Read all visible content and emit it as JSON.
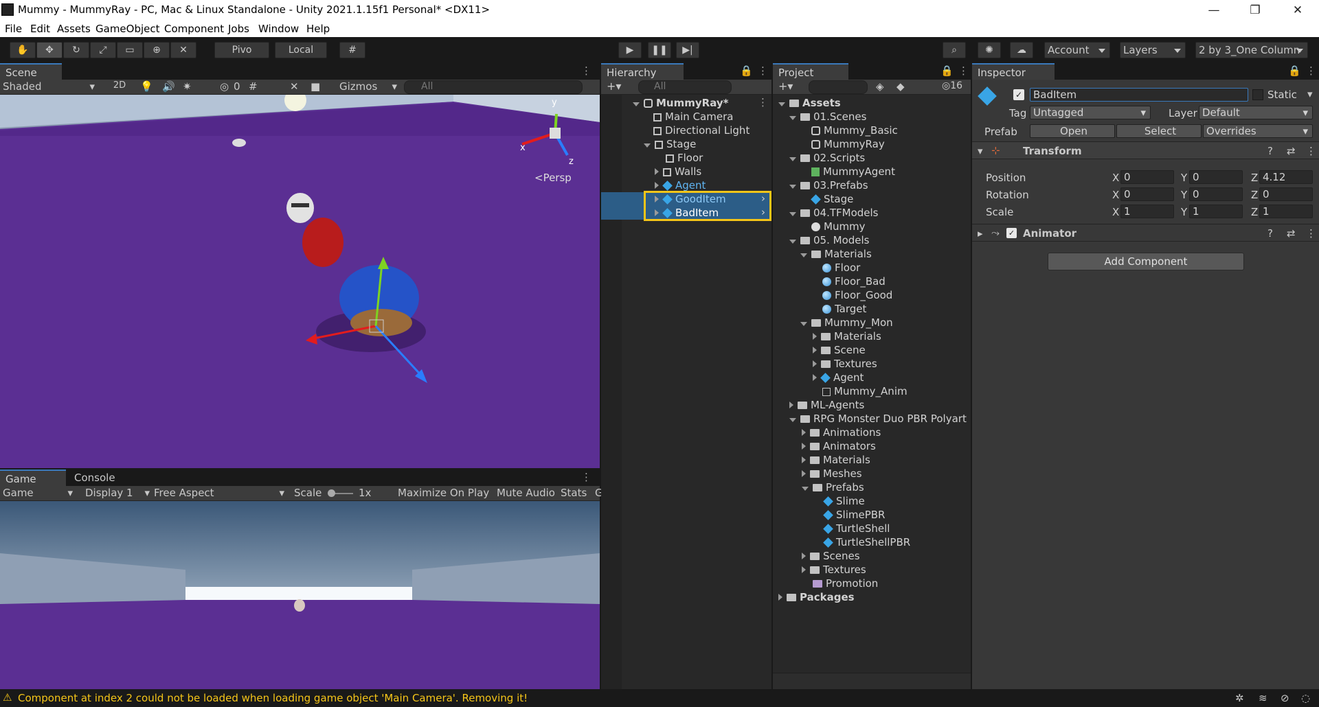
{
  "window": {
    "title": "Mummy - MummyRay - PC, Mac & Linux Standalone - Unity 2021.1.15f1 Personal* <DX11>"
  },
  "menu": [
    "File",
    "Edit",
    "Assets",
    "GameObject",
    "Component",
    "Jobs",
    "Window",
    "Help"
  ],
  "toolbar": {
    "pivot": "Pivo",
    "local": "Local",
    "account": "Account",
    "layers": "Layers",
    "layout": "2 by 3_One Column"
  },
  "scene": {
    "tab": "Scene",
    "shading": "Shaded",
    "mode2d": "2D",
    "hidden_count": "0",
    "gizmos": "Gizmos",
    "search_placeholder": "All",
    "persp": "<Persp",
    "axis_x": "x",
    "axis_y": "y",
    "axis_z": "z"
  },
  "game": {
    "tab_game": "Game",
    "tab_console": "Console",
    "view": "Game",
    "display": "Display 1",
    "aspect": "Free Aspect",
    "scale_label": "Scale",
    "scale_value": "1x",
    "maximize": "Maximize On Play",
    "mute": "Mute Audio",
    "stats": "Stats",
    "gizmos_cut": "G"
  },
  "hierarchy": {
    "tab": "Hierarchy",
    "search_placeholder": "All",
    "scene_root": "MummyRay*",
    "items": [
      "Main Camera",
      "Directional Light",
      "Stage",
      "Floor",
      "Walls",
      "Agent",
      "GoodItem",
      "BadItem"
    ]
  },
  "project": {
    "tab": "Project",
    "hidden_count": "16",
    "items": [
      "Assets",
      "01.Scenes",
      "Mummy_Basic",
      "MummyRay",
      "02.Scripts",
      "MummyAgent",
      "03.Prefabs",
      "Stage",
      "04.TFModels",
      "Mummy",
      "05. Models",
      "Materials",
      "Floor",
      "Floor_Bad",
      "Floor_Good",
      "Target",
      "Mummy_Mon",
      "Materials",
      "Scene",
      "Textures",
      "Agent",
      "Mummy_Anim",
      "ML-Agents",
      "RPG Monster Duo PBR Polyart",
      "Animations",
      "Animators",
      "Materials",
      "Meshes",
      "Prefabs",
      "Slime",
      "SlimePBR",
      "TurtleShell",
      "TurtleShellPBR",
      "Scenes",
      "Textures",
      "Promotion",
      "Packages"
    ]
  },
  "inspector": {
    "tab": "Inspector",
    "object_name": "BadItem",
    "static_label": "Static",
    "tag_label": "Tag",
    "tag_value": "Untagged",
    "layer_label": "Layer",
    "layer_value": "Default",
    "prefab_label": "Prefab",
    "open": "Open",
    "select": "Select",
    "overrides": "Overrides",
    "transform_title": "Transform",
    "position_label": "Position",
    "rotation_label": "Rotation",
    "scale_label": "Scale",
    "x": "X",
    "y": "Y",
    "z": "Z",
    "position": [
      "0",
      "0",
      "4.12"
    ],
    "rotation": [
      "0",
      "0",
      "0"
    ],
    "scale": [
      "1",
      "1",
      "1"
    ],
    "animator_title": "Animator",
    "add_component": "Add Component"
  },
  "status": {
    "message": "Component at index 2 could not be loaded when loading game object 'Main Camera'. Removing it!"
  },
  "colors": {
    "floor": "#5b2f93",
    "highlight": "#f5c518",
    "prefab_blue": "#39a5e6"
  }
}
